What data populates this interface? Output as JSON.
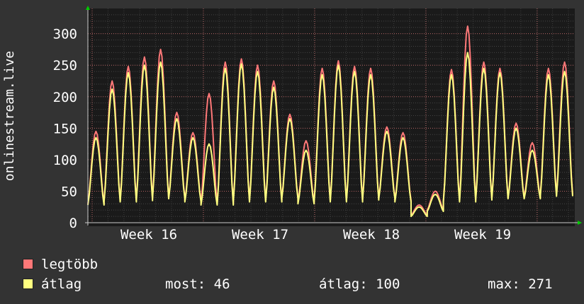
{
  "chart_data": {
    "type": "line",
    "ylabel": "onlinestream.live",
    "yticks": [
      0,
      50,
      100,
      150,
      200,
      250,
      300
    ],
    "ylim": [
      0,
      340
    ],
    "xticks": [
      "Week 16",
      "Week 17",
      "Week 18",
      "Week 19"
    ],
    "grid": true,
    "series": [
      {
        "name": "legtöbb",
        "color": "#ff7878",
        "days": [
          {
            "peak": 145,
            "trough": 30
          },
          {
            "peak": 225,
            "trough": 35
          },
          {
            "peak": 248,
            "trough": 35
          },
          {
            "peak": 263,
            "trough": 38
          },
          {
            "peak": 275,
            "trough": 40
          },
          {
            "peak": 175,
            "trough": 40
          },
          {
            "peak": 143,
            "trough": 35
          },
          {
            "peak": 205,
            "trough": 30
          },
          {
            "peak": 255,
            "trough": 30
          },
          {
            "peak": 260,
            "trough": 35
          },
          {
            "peak": 250,
            "trough": 35
          },
          {
            "peak": 225,
            "trough": 35
          },
          {
            "peak": 172,
            "trough": 40
          },
          {
            "peak": 130,
            "trough": 32
          },
          {
            "peak": 245,
            "trough": 35
          },
          {
            "peak": 257,
            "trough": 35
          },
          {
            "peak": 248,
            "trough": 35
          },
          {
            "peak": 245,
            "trough": 38
          },
          {
            "peak": 152,
            "trough": 40
          },
          {
            "peak": 143,
            "trough": 35
          },
          {
            "peak": 28,
            "trough": 12
          },
          {
            "peak": 50,
            "trough": 20
          },
          {
            "peak": 243,
            "trough": 35
          },
          {
            "peak": 312,
            "trough": 35
          },
          {
            "peak": 255,
            "trough": 38
          },
          {
            "peak": 245,
            "trough": 40
          },
          {
            "peak": 158,
            "trough": 40
          },
          {
            "peak": 127,
            "trough": 40
          },
          {
            "peak": 245,
            "trough": 45
          },
          {
            "peak": 255,
            "trough": 45
          }
        ]
      },
      {
        "name": "átlag",
        "color": "#ffff80",
        "days": [
          {
            "peak": 135,
            "trough": 28
          },
          {
            "peak": 212,
            "trough": 33
          },
          {
            "peak": 238,
            "trough": 33
          },
          {
            "peak": 250,
            "trough": 35
          },
          {
            "peak": 255,
            "trough": 38
          },
          {
            "peak": 165,
            "trough": 38
          },
          {
            "peak": 135,
            "trough": 33
          },
          {
            "peak": 125,
            "trough": 28
          },
          {
            "peak": 245,
            "trough": 28
          },
          {
            "peak": 252,
            "trough": 33
          },
          {
            "peak": 240,
            "trough": 33
          },
          {
            "peak": 215,
            "trough": 33
          },
          {
            "peak": 165,
            "trough": 38
          },
          {
            "peak": 115,
            "trough": 30
          },
          {
            "peak": 235,
            "trough": 33
          },
          {
            "peak": 250,
            "trough": 33
          },
          {
            "peak": 240,
            "trough": 33
          },
          {
            "peak": 235,
            "trough": 36
          },
          {
            "peak": 145,
            "trough": 38
          },
          {
            "peak": 135,
            "trough": 33
          },
          {
            "peak": 25,
            "trough": 10
          },
          {
            "peak": 45,
            "trough": 18
          },
          {
            "peak": 235,
            "trough": 33
          },
          {
            "peak": 270,
            "trough": 33
          },
          {
            "peak": 245,
            "trough": 36
          },
          {
            "peak": 238,
            "trough": 38
          },
          {
            "peak": 150,
            "trough": 38
          },
          {
            "peak": 115,
            "trough": 38
          },
          {
            "peak": 235,
            "trough": 42
          },
          {
            "peak": 240,
            "trough": 42
          }
        ]
      }
    ]
  },
  "legend": {
    "max_label": "legtöbb",
    "avg_label": "átlag",
    "max_color": "#ff7878",
    "avg_color": "#ffff80",
    "now_text": "most: 46",
    "avg_text": "átlag: 100",
    "max_text": "max: 271"
  }
}
